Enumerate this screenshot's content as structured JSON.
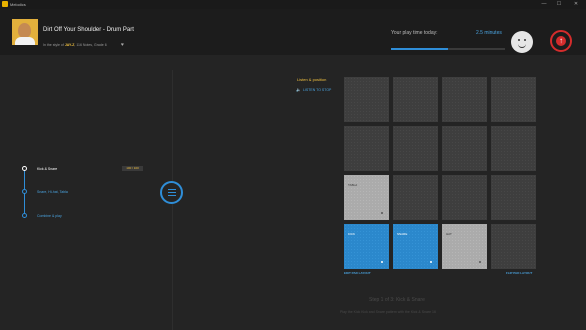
{
  "window": {
    "app_name": "Melodics",
    "controls": {
      "minimize": "—",
      "maximize": "☐",
      "close": "✕"
    }
  },
  "header": {
    "song_title": "Dirt Off Your Shoulder - Drum Part",
    "meta_prefix": "In the style of",
    "artist": "JAY-Z",
    "meta_suffix": ", 116 Notes, Grade 6",
    "heart_icon": "♥",
    "playtime_label": "Your play time today:",
    "playtime_value": "2.5 minutes",
    "playtime_progress": 0.5,
    "upload_icon": "↑"
  },
  "timeline": {
    "steps": [
      {
        "label": "Kick & Snare",
        "state": "active"
      },
      {
        "label": "Snare, Hi-hat, Tabla",
        "state": "todo"
      },
      {
        "label": "Combine & play",
        "state": "todo"
      }
    ],
    "score_badge": "100 / 100"
  },
  "listen": {
    "title": "Listen & position",
    "stop_label": "LISTEN TO STOP",
    "speaker_icon": "🔈"
  },
  "pads": [
    {
      "label": "",
      "style": "dark"
    },
    {
      "label": "",
      "style": "dark"
    },
    {
      "label": "",
      "style": "dark"
    },
    {
      "label": "",
      "style": "dark"
    },
    {
      "label": "",
      "style": "dark"
    },
    {
      "label": "",
      "style": "dark"
    },
    {
      "label": "",
      "style": "dark"
    },
    {
      "label": "",
      "style": "dark"
    },
    {
      "label": "TABLA",
      "style": "light"
    },
    {
      "label": "",
      "style": "dark"
    },
    {
      "label": "",
      "style": "dark"
    },
    {
      "label": "",
      "style": "dark"
    },
    {
      "label": "KICK",
      "style": "blue"
    },
    {
      "label": "SNARE",
      "style": "blue"
    },
    {
      "label": "HAT",
      "style": "light"
    },
    {
      "label": "",
      "style": "dark"
    }
  ],
  "pad_links": {
    "edit": "EDIT PAD LAYOUT",
    "flip": "FLIP PAD LAYOUT"
  },
  "footer": {
    "step_caption": "Step 1 of 3: Kick & Snare",
    "instruction": "Play the Kick Kick and Snare pattern with the Kick & Snare 16"
  },
  "colors": {
    "accent_blue": "#2f8ed8",
    "accent_yellow": "#f0c040",
    "alert_red": "#d42c2c"
  }
}
